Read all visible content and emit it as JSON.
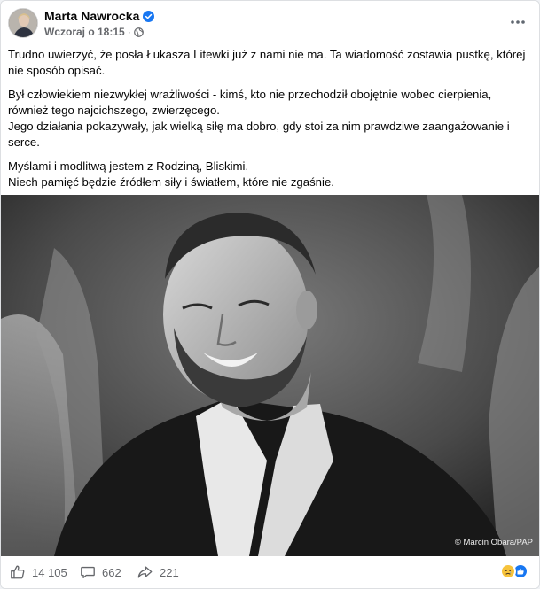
{
  "post": {
    "author": "Marta Nawrocka",
    "timestamp": "Wczoraj o 18:15",
    "separator": "·",
    "paragraphs": [
      {
        "lines": [
          "Trudno uwierzyć, że posła Łukasza Litewki już z nami nie ma. Ta wiadomość zostawia pustkę, której",
          "nie sposób opisać."
        ]
      },
      {
        "lines": [
          "Był człowiekiem niezwykłej wrażliwości - kimś, kto nie przechodził obojętnie wobec cierpienia,",
          "również tego najcichszego, zwierzęcego.",
          "Jego działania pokazywały, jak wielką siłę ma dobro, gdy stoi za nim prawdziwe zaangażowanie i",
          "serce."
        ]
      },
      {
        "lines": [
          "Myślami i modlitwą jestem z Rodziną, Bliskimi.",
          "Niech pamięć będzie źródłem siły i światłem, które nie zgaśnie."
        ]
      }
    ],
    "photo_credit": "© Marcin Obara/PAP"
  },
  "footer": {
    "likes": "14 105",
    "comments": "662",
    "shares": "221"
  },
  "colors": {
    "secondary_text": "#65676b",
    "verified_blue": "#1877f2",
    "card_border": "#dddfe2"
  },
  "icons": {
    "verified": "verified-badge-icon",
    "privacy": "globe-icon",
    "more": "more-options-icon",
    "like": "thumbs-up-icon",
    "comment": "comment-icon",
    "share": "share-icon",
    "reactions": [
      "sad-reaction-icon",
      "like-reaction-icon"
    ]
  }
}
